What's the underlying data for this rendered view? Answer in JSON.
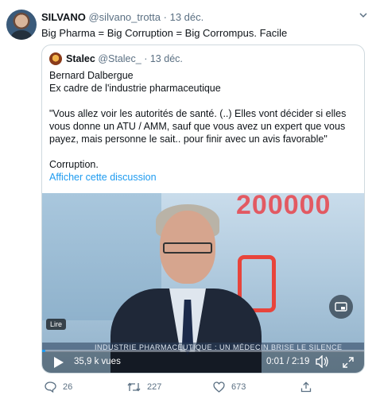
{
  "tweet": {
    "author_name": "SILVANO",
    "author_handle": "@silvano_trotta",
    "separator": "·",
    "date": "13 déc.",
    "text": "Big Pharma = Big Corruption = Big Corrompus. Facile"
  },
  "quoted_tweet": {
    "author_name": "Stalec",
    "author_handle": "@Stalec_",
    "separator": "·",
    "date": "13 déc.",
    "lines": [
      "Bernard Dalbergue",
      "Ex cadre de l'industrie pharmaceutique",
      "\"Vous allez voir les autorités de santé. (..) Elles vont décider si elles vous donne un ATU / AMM, sauf que vous avez un expert que vous payez, mais personne le sait.. pour finir avec un avis favorable\"",
      "Corruption."
    ],
    "link": "Afficher cette discussion"
  },
  "video": {
    "overlay_number": "200000",
    "ticker_text": "INDUSTRIE PHARMACEUTIQUE : UN MÉDECIN BRISE LE SILENCE",
    "read_label": "Lire",
    "views": "35,9 k vues",
    "time": "0:01 / 2:19",
    "progress_fraction": 0.007
  },
  "actions": {
    "replies": "26",
    "retweets": "227",
    "likes": "673"
  },
  "colors": {
    "accent": "#1d9bf0",
    "muted": "#5b7083",
    "border": "#cfd9de"
  }
}
